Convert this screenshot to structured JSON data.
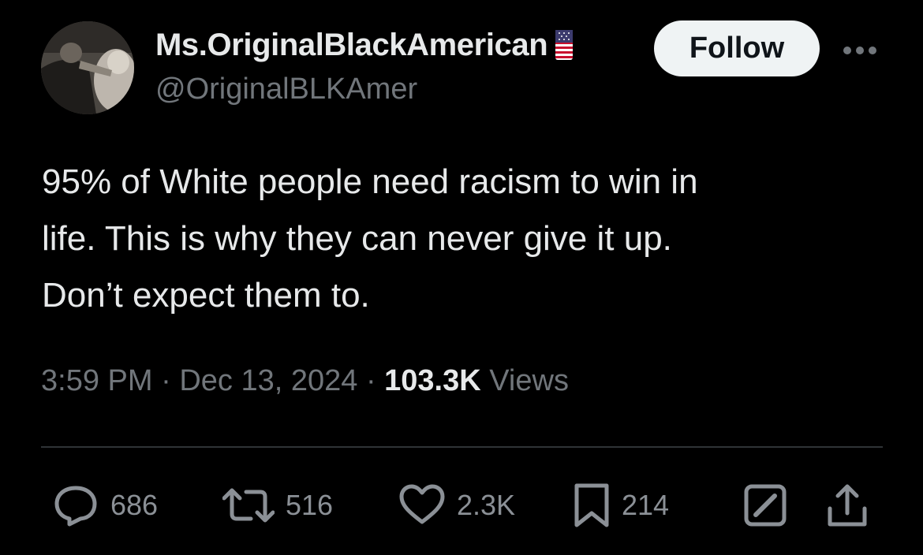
{
  "author": {
    "display_name": "Ms.OriginalBlackAmerican",
    "handle": "@OriginalBLKAmer",
    "badge_icon": "us-flag-icon"
  },
  "follow_label": "Follow",
  "more_icon": "more-horizontal-icon",
  "tweet": {
    "lines": [
      "95% of White people need racism to win in",
      "life. This is why they can never give it up.",
      "Don’t expect them to."
    ]
  },
  "meta": {
    "time": "3:59 PM",
    "separator": "·",
    "date": "Dec 13, 2024",
    "views_count": "103.3K",
    "views_label": "Views"
  },
  "actions": {
    "reply": {
      "icon": "reply-icon",
      "count": "686"
    },
    "retweet": {
      "icon": "retweet-icon",
      "count": "516"
    },
    "like": {
      "icon": "heart-icon",
      "count": "2.3K"
    },
    "bookmark": {
      "icon": "bookmark-icon",
      "count": "214"
    },
    "grok": {
      "icon": "grok-icon"
    },
    "share": {
      "icon": "share-icon"
    }
  },
  "colors": {
    "background": "#000000",
    "primary_text": "#e7e9ea",
    "secondary_text": "#71767b",
    "divider": "#2f3336",
    "follow_bg": "#eff3f4"
  }
}
